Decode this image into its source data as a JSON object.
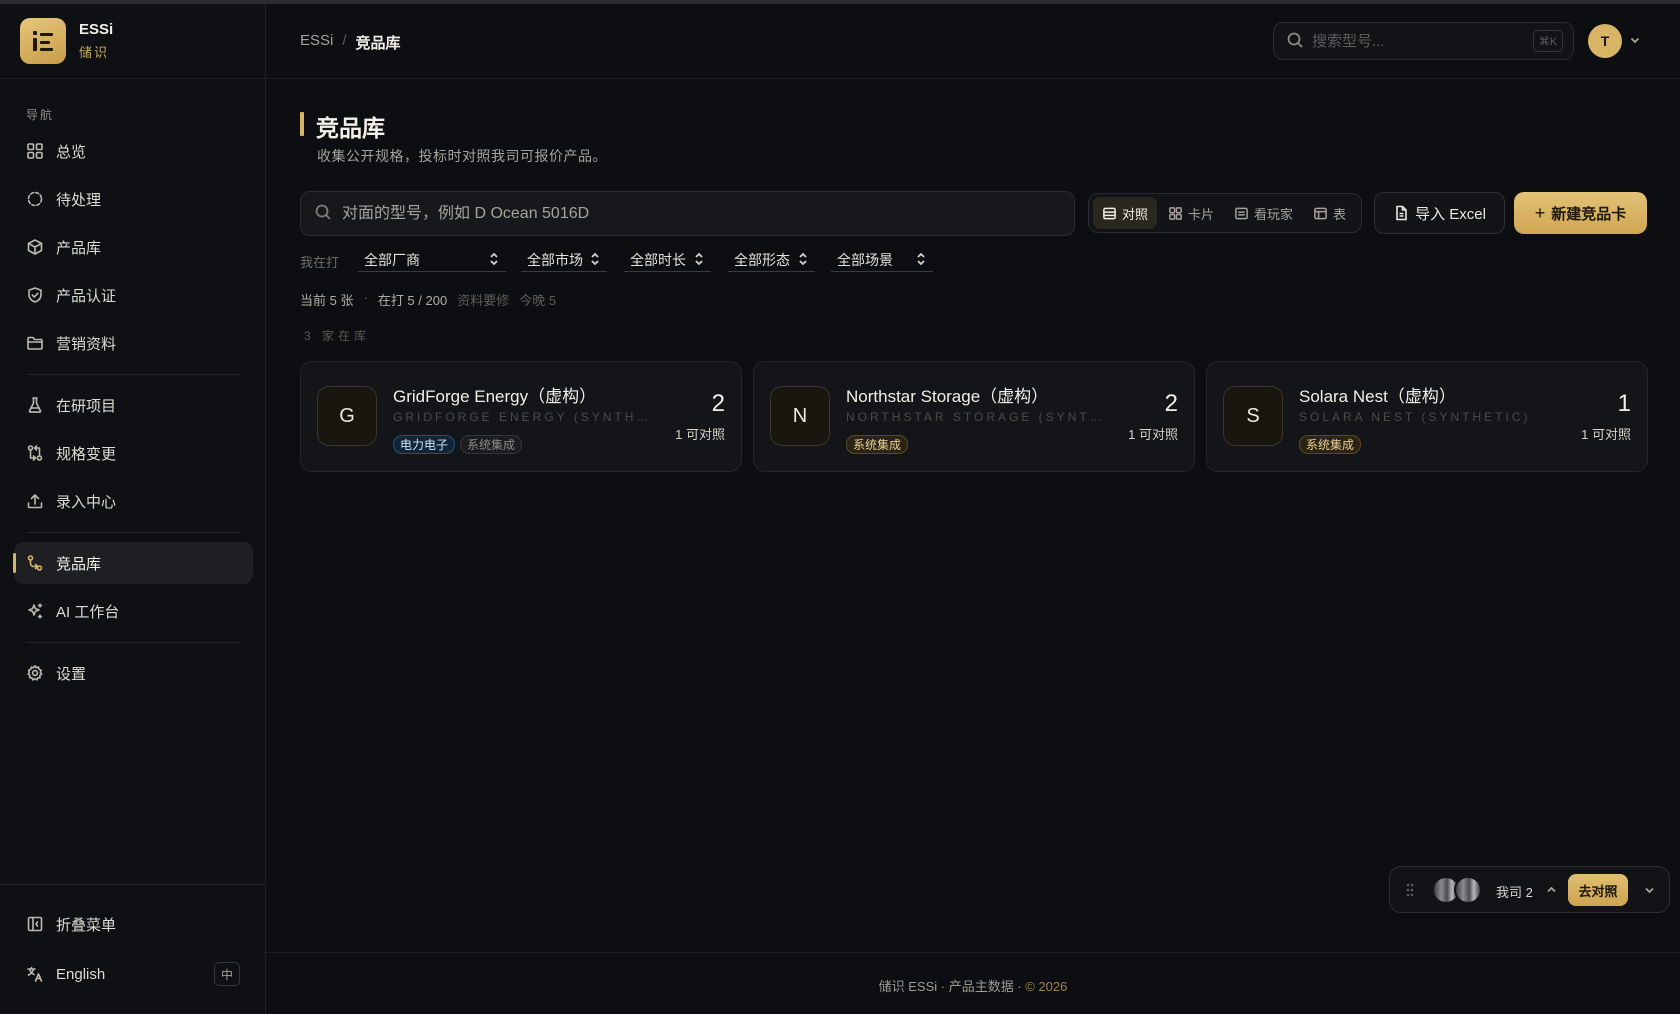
{
  "brand": {
    "name": "ESSi",
    "subtitle": "储识"
  },
  "nav": {
    "section": "导航",
    "items": [
      {
        "label": "总览",
        "icon": "grid-icon"
      },
      {
        "label": "待处理",
        "icon": "dashed-circle-icon"
      },
      {
        "label": "产品库",
        "icon": "box-icon"
      },
      {
        "label": "产品认证",
        "icon": "shield-check-icon"
      },
      {
        "label": "营销资料",
        "icon": "folder-icon"
      },
      {
        "label": "在研项目",
        "icon": "flask-icon"
      },
      {
        "label": "规格变更",
        "icon": "git-compare-icon"
      },
      {
        "label": "录入中心",
        "icon": "upload-icon"
      },
      {
        "label": "竞品库",
        "icon": "swap-icon",
        "active": true
      },
      {
        "label": "AI 工作台",
        "icon": "sparkles-icon"
      },
      {
        "label": "设置",
        "icon": "gear-icon"
      }
    ],
    "collapse": "折叠菜单",
    "language": "English",
    "language_toggle": "中"
  },
  "header": {
    "breadcrumb": [
      "ESSi",
      "竞品库"
    ],
    "search_placeholder": "搜索型号...",
    "search_shortcut": "⌘K",
    "avatar_initial": "T"
  },
  "main": {
    "title": "竞品库",
    "subtitle": "收集公开规格，投标时对照我司可报价产品。",
    "search_placeholder": "对面的型号，例如 D Ocean 5016D",
    "views": [
      {
        "label": "对照",
        "active": true
      },
      {
        "label": "卡片"
      },
      {
        "label": "看玩家"
      },
      {
        "label": "表"
      }
    ],
    "import_label": "导入 Excel",
    "new_label": "新建竞品卡",
    "filter_label": "我在打",
    "filters": [
      "全部厂商",
      "全部市场",
      "全部时长",
      "全部形态",
      "全部场景"
    ],
    "stats": {
      "current": "当前 5 张",
      "in_progress": "在打 5 / 200",
      "needs_fix": "资料要修",
      "tonight": "今晚 5"
    },
    "count_line": "3 家在库",
    "cards": [
      {
        "initial": "G",
        "name": "GridForge Energy（虚构）",
        "name_en": "GRIDFORGE ENERGY (SYNTHETIC)",
        "tags": [
          {
            "label": "电力电子",
            "style": "blue"
          },
          {
            "label": "系统集成",
            "style": "gray"
          }
        ],
        "count": "2",
        "count_label": "1 可对照"
      },
      {
        "initial": "N",
        "name": "Northstar Storage（虚构）",
        "name_en": "NORTHSTAR STORAGE (SYNTHETIC)",
        "tags": [
          {
            "label": "系统集成",
            "style": "gold"
          }
        ],
        "count": "2",
        "count_label": "1 可对照"
      },
      {
        "initial": "S",
        "name": "Solara Nest（虚构）",
        "name_en": "SOLARA NEST (SYNTHETIC)",
        "tags": [
          {
            "label": "系统集成",
            "style": "gold"
          }
        ],
        "count": "1",
        "count_label": "1 可对照"
      }
    ]
  },
  "compare_bar": {
    "label": "我司 2",
    "go_label": "去对照"
  },
  "footer": {
    "text": "储识 ESSi · 产品主数据 · ",
    "copyright": "© 2026"
  },
  "colors": {
    "accent": "#d6b463",
    "background": "#0d0e11",
    "tag_blue": "#24507a"
  }
}
